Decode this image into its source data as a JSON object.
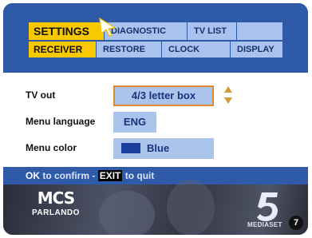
{
  "header": {
    "tabs_top": [
      {
        "label": "SETTINGS",
        "active": true
      },
      {
        "label": "DIAGNOSTIC",
        "active": false
      },
      {
        "label": "TV LIST",
        "active": false
      },
      {
        "label": "",
        "active": false
      }
    ],
    "tabs_bottom": [
      {
        "label": "RECEIVER",
        "active": true
      },
      {
        "label": "RESTORE",
        "active": false
      },
      {
        "label": "CLOCK",
        "active": false
      },
      {
        "label": "DISPLAY",
        "active": false
      }
    ]
  },
  "settings": {
    "tv_out": {
      "label": "TV out",
      "value": "4/3 letter box"
    },
    "menu_language": {
      "label": "Menu language",
      "value": "ENG"
    },
    "menu_color": {
      "label": "Menu color",
      "value": "Blue",
      "swatch_color": "#1b3f9c"
    }
  },
  "instructions": {
    "ok_key": "OK",
    "confirm_text": "to confirm -",
    "exit_key": "EXIT",
    "quit_text": "to quit"
  },
  "background": {
    "show_logo_top": "MCS",
    "show_logo_bottom": "PARLANDO",
    "channel_name": "MEDIASET"
  },
  "badge": "7",
  "colors": {
    "header_blue": "#2e5aa8",
    "active_tab": "#f8c800",
    "inactive_tab": "#a9c3ee",
    "value_box": "#aac4ec",
    "selected_border": "#e08a2c",
    "arrow": "#d19a3a"
  }
}
